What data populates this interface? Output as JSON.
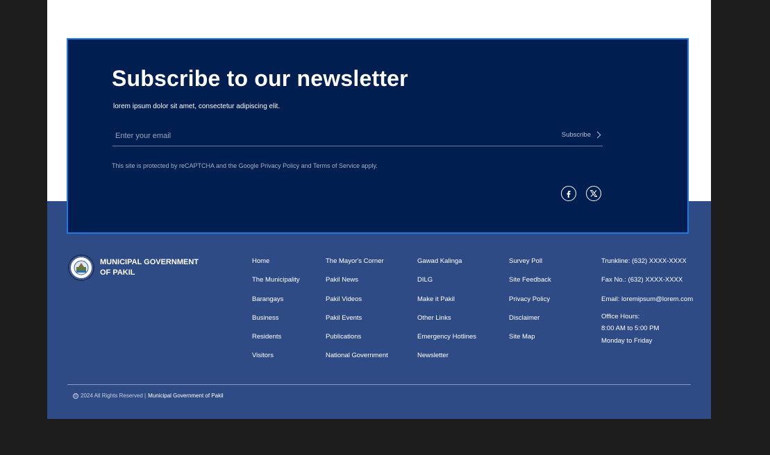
{
  "newsletter": {
    "title": "Subscribe to our newsletter",
    "subtitle": "lorem ipsum dolor sit amet, consectetur adipiscing elit.",
    "email_placeholder": "Enter your email",
    "subscribe_label": "Subscribe",
    "legal": "This site is protected by reCAPTCHA and the Google Privacy Policy and Terms of Service apply."
  },
  "social": [
    "facebook-icon",
    "x-icon"
  ],
  "brand": {
    "line1": "MUNICIPAL GOVERNMENT",
    "line2": "OF PAKIL"
  },
  "nav": {
    "col1": [
      "Home",
      "The Municipality",
      "Barangays",
      "Business",
      "Residents",
      "Visitors"
    ],
    "col2": [
      "The Mayor's Corner",
      "Pakil News",
      "Pakil Videos",
      "Pakil Events",
      "Publications",
      "National Government"
    ],
    "col3": [
      "Gawad Kalinga",
      "DILG",
      "Make it Pakil",
      "Other Links",
      "Emergency Hotlines",
      "Newsletter"
    ],
    "col4": [
      "Survey Poll",
      "Site Feedback",
      "Privacy Policy",
      "Disclaimer",
      "Site Map"
    ]
  },
  "contact": {
    "trunkline": "Trunkline: (632) XXXX-XXXX",
    "fax": "Fax No.: (632) XXXX-XXXX",
    "email": "Email: loremipsum@lorem.com",
    "hours_label": "Office Hours:",
    "hours_time": "8:00 AM to 5:00 PM",
    "hours_days": "Monday to Friday"
  },
  "footer": {
    "copyright_prefix": "2024 All Rights Reserved |",
    "copyright_owner": "Municipal Government of Pakil"
  },
  "colors": {
    "background": "#1d1d1d",
    "newsletter_bg": "#001e4f",
    "newsletter_border": "#1e78e6",
    "footer_bg": "#2e4b85"
  }
}
